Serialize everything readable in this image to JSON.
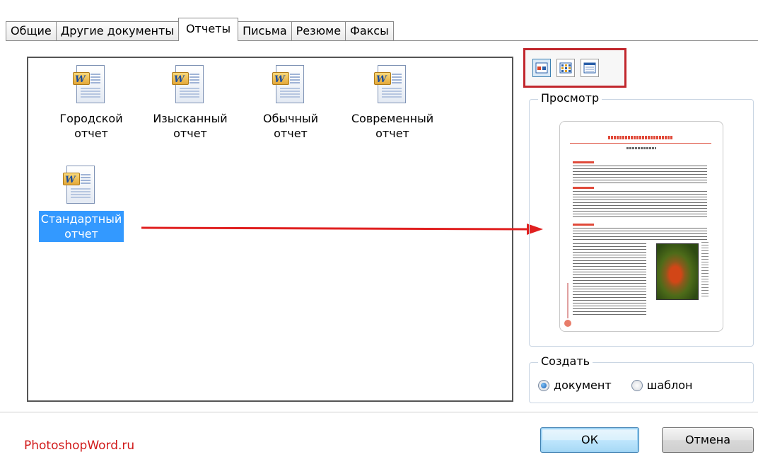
{
  "tabs": [
    {
      "label": "Общие",
      "active": false
    },
    {
      "label": "Другие документы",
      "active": false
    },
    {
      "label": "Отчеты",
      "active": true
    },
    {
      "label": "Письма",
      "active": false
    },
    {
      "label": "Резюме",
      "active": false
    },
    {
      "label": "Факсы",
      "active": false
    }
  ],
  "templates": [
    {
      "line1": "Городской",
      "line2": "отчет",
      "icon": "word-document-icon",
      "selected": false
    },
    {
      "line1": "Изысканный",
      "line2": "отчет",
      "icon": "word-document-icon",
      "selected": false
    },
    {
      "line1": "Обычный",
      "line2": "отчет",
      "icon": "word-document-icon",
      "selected": false
    },
    {
      "line1": "Современный",
      "line2": "отчет",
      "icon": "word-document-icon",
      "selected": false
    },
    {
      "line1": "Стандартный",
      "line2": "отчет",
      "icon": "word-document-icon",
      "selected": true
    }
  ],
  "view_buttons": [
    {
      "icon": "large-icons-view-icon",
      "active": true
    },
    {
      "icon": "list-view-icon",
      "active": false
    },
    {
      "icon": "details-view-icon",
      "active": false
    }
  ],
  "preview": {
    "legend": "Просмотр"
  },
  "create": {
    "legend": "Создать",
    "options": [
      {
        "label": "документ",
        "checked": true
      },
      {
        "label": "шаблон",
        "checked": false
      }
    ]
  },
  "buttons": {
    "ok": "ОК",
    "cancel": "Отмена"
  },
  "watermark": "PhotoshopWord.ru",
  "colors": {
    "selection": "#3399ff",
    "highlight_frame": "#c1272d",
    "arrow": "#e02020",
    "watermark": "#d11a1a"
  }
}
